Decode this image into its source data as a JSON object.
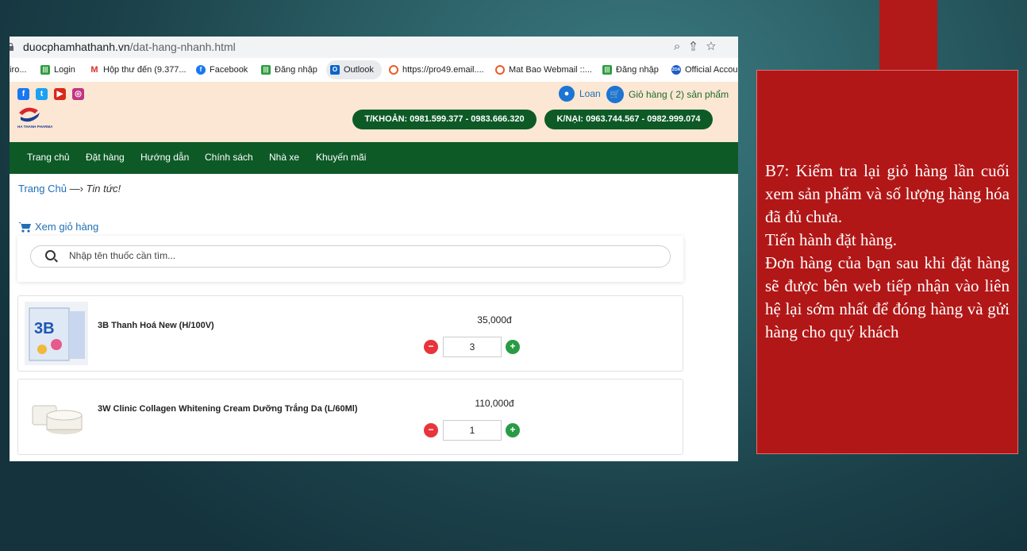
{
  "browser": {
    "url_host": "duocphamhathanh.vn",
    "url_path": "/dat-hang-nhanh.html",
    "bookmarks": [
      {
        "label": "biro...",
        "icon": "none"
      },
      {
        "label": "Login",
        "icon": "bars-green-icon"
      },
      {
        "label": "Hộp thư đến (9.377...",
        "icon": "gmail-icon"
      },
      {
        "label": "Facebook",
        "icon": "facebook-icon"
      },
      {
        "label": "Đăng nhập",
        "icon": "bars-green-icon"
      },
      {
        "label": "Outlook",
        "icon": "outlook-icon"
      },
      {
        "label": "https://pro49.email....",
        "icon": "ring-icon"
      },
      {
        "label": "Mat Bao Webmail ::...",
        "icon": "ring-icon"
      },
      {
        "label": "Đăng nhập",
        "icon": "bars-green-icon"
      },
      {
        "label": "Official Accou",
        "icon": "zoa-icon"
      }
    ]
  },
  "header": {
    "brand": "HA THANH PHARMA",
    "user_label": "Loan",
    "cart_label": "Giỏ hàng ( 2) sản phẩm",
    "hotline_account": "T/KHOẢN: 0981.599.377 - 0983.666.320",
    "hotline_complaint": "K/NẠI: 0963.744.567 - 0982.999.074"
  },
  "nav": [
    "Trang chủ",
    "Đặt hàng",
    "Hướng dẫn",
    "Chính sách",
    "Nhà xe",
    "Khuyến mãi"
  ],
  "breadcrumb": {
    "home": "Trang Chủ",
    "sep": "—›",
    "current": "Tin tức!"
  },
  "view_cart": "Xem giỏ hàng",
  "search": {
    "placeholder": "Nhập tên thuốc cần tìm..."
  },
  "products": [
    {
      "name": "3B Thanh Hoá New (H/100V)",
      "price": "35,000đ",
      "qty": "3"
    },
    {
      "name": "3W Clinic Collagen Whitening Cream Dưỡng Trắng Da (L/60Ml)",
      "price": "110,000đ",
      "qty": "1"
    }
  ],
  "note": {
    "lines": [
      "B7: Kiểm tra lại giỏ hàng lần cuối xem sản phẩm và số lượng hàng hóa đã đủ chưa.",
      "Tiến hành đặt hàng.",
      "Đơn hàng của bạn sau khi đặt hàng sẽ được bên web tiếp nhận vào liên hệ lại sớm nhất để đóng hàng và gửi hàng cho quý khách"
    ]
  },
  "colors": {
    "accent_green": "#0d5a27",
    "slide_red": "#b21717",
    "link_blue": "#1f6fb3"
  }
}
